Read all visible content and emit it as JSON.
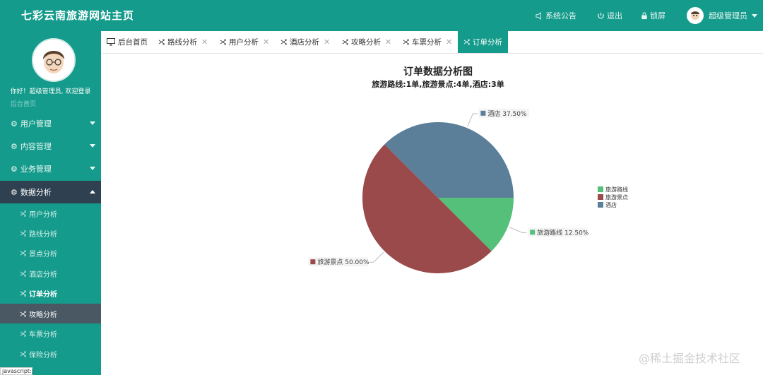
{
  "header": {
    "title": "七彩云南旅游网站主页",
    "notice_label": "系统公告",
    "logout_label": "退出",
    "lock_label": "锁屏",
    "user_label": "超级管理员"
  },
  "sidebar": {
    "welcome": "你好！超级管理员, 欢迎登录",
    "hidden_item": "后台首页",
    "menus": [
      {
        "label": "用户管理"
      },
      {
        "label": "内容管理"
      },
      {
        "label": "业务管理"
      },
      {
        "label": "数据分析"
      }
    ],
    "sub_items": [
      {
        "label": "用户分析"
      },
      {
        "label": "路线分析"
      },
      {
        "label": "景点分析"
      },
      {
        "label": "酒店分析"
      },
      {
        "label": "订单分析"
      },
      {
        "label": "攻略分析"
      },
      {
        "label": "车票分析"
      },
      {
        "label": "保险分析"
      }
    ]
  },
  "tabs": [
    {
      "label": "后台首页"
    },
    {
      "label": "路线分析"
    },
    {
      "label": "用户分析"
    },
    {
      "label": "酒店分析"
    },
    {
      "label": "攻略分析"
    },
    {
      "label": "车票分析"
    },
    {
      "label": "订单分析"
    }
  ],
  "chart_data": {
    "type": "pie",
    "title": "订单数据分析图",
    "subtitle": "旅游路线:1单,旅游景点:4单,酒店:3单",
    "slices": [
      {
        "name": "旅游路线",
        "value": 1,
        "percent": "12.50%",
        "color": "#55c07a"
      },
      {
        "name": "旅游景点",
        "value": 4,
        "percent": "50.00%",
        "color": "#9a4a4a"
      },
      {
        "name": "酒店",
        "value": 3,
        "percent": "37.50%",
        "color": "#5b7f99"
      }
    ],
    "legend_position": "right"
  },
  "status_text": "javascript:;",
  "watermark": "@稀土掘金技术社区"
}
